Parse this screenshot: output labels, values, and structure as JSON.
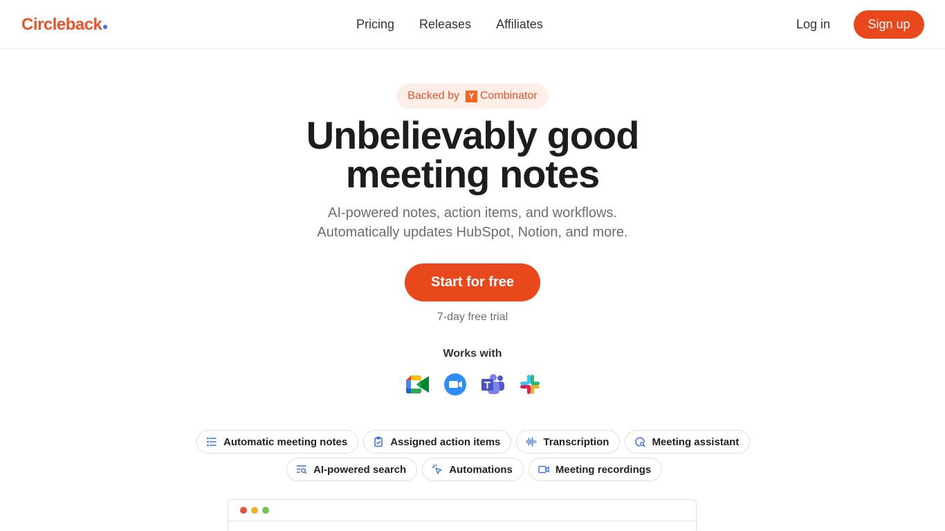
{
  "brand": {
    "name": "Circleback",
    "color": "#e8532a",
    "dot_color": "#3b6fe0"
  },
  "nav": {
    "items": [
      "Pricing",
      "Releases",
      "Affiliates"
    ]
  },
  "auth": {
    "login": "Log in",
    "signup": "Sign up"
  },
  "hero": {
    "badge_prefix": "Backed by",
    "badge_logo": "Y",
    "badge_suffix": "Combinator",
    "headline_line1": "Unbelievably good",
    "headline_line2": "meeting notes",
    "sub_line1": "AI-powered notes, action items, and workflows.",
    "sub_line2": "Automatically updates HubSpot, Notion, and more.",
    "cta": "Start for free",
    "trial": "7-day free trial",
    "works_with": "Works with",
    "integrations": [
      "google-meet-icon",
      "zoom-icon",
      "microsoft-teams-icon",
      "slack-icon"
    ]
  },
  "features": {
    "row1": [
      {
        "label": "Automatic meeting notes",
        "icon": "list-icon"
      },
      {
        "label": "Assigned action items",
        "icon": "clipboard-check-icon"
      },
      {
        "label": "Transcription",
        "icon": "audio-wave-icon"
      },
      {
        "label": "Meeting assistant",
        "icon": "assistant-icon"
      }
    ],
    "row2": [
      {
        "label": "AI-powered search",
        "icon": "search-list-icon"
      },
      {
        "label": "Automations",
        "icon": "cursor-click-icon"
      },
      {
        "label": "Meeting recordings",
        "icon": "video-icon"
      }
    ]
  },
  "preview": {
    "window_dots": [
      "#e5533d",
      "#e9b52b",
      "#72c056"
    ]
  },
  "colors": {
    "accent": "#e8481b",
    "icon_blue": "#3b6fe0"
  }
}
